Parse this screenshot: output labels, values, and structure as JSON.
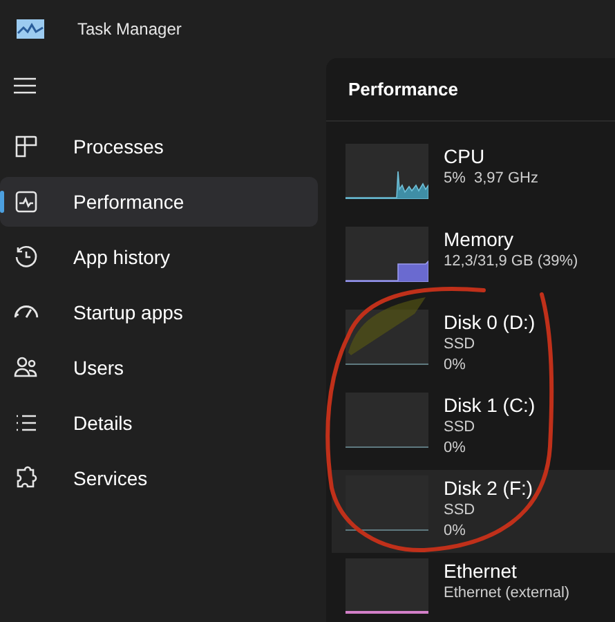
{
  "window": {
    "title": "Task Manager"
  },
  "sidebar": {
    "items": [
      {
        "label": "Processes",
        "selected": false
      },
      {
        "label": "Performance",
        "selected": true
      },
      {
        "label": "App history",
        "selected": false
      },
      {
        "label": "Startup apps",
        "selected": false
      },
      {
        "label": "Users",
        "selected": false
      },
      {
        "label": "Details",
        "selected": false
      },
      {
        "label": "Services",
        "selected": false
      }
    ]
  },
  "panel": {
    "title": "Performance",
    "devices": [
      {
        "kind": "cpu",
        "name": "CPU",
        "lines": [
          "5%  3,97 GHz"
        ],
        "selected": false
      },
      {
        "kind": "memory",
        "name": "Memory",
        "lines": [
          "12,3/31,9 GB (39%)"
        ],
        "selected": false
      },
      {
        "kind": "disk",
        "name": "Disk 0 (D:)",
        "lines": [
          "SSD",
          "0%"
        ],
        "selected": false
      },
      {
        "kind": "disk",
        "name": "Disk 1 (C:)",
        "lines": [
          "SSD",
          "0%"
        ],
        "selected": false
      },
      {
        "kind": "disk",
        "name": "Disk 2 (F:)",
        "lines": [
          "SSD",
          "0%"
        ],
        "selected": true
      },
      {
        "kind": "network",
        "name": "Ethernet",
        "lines": [
          "Ethernet (external)"
        ],
        "selected": false
      }
    ]
  }
}
